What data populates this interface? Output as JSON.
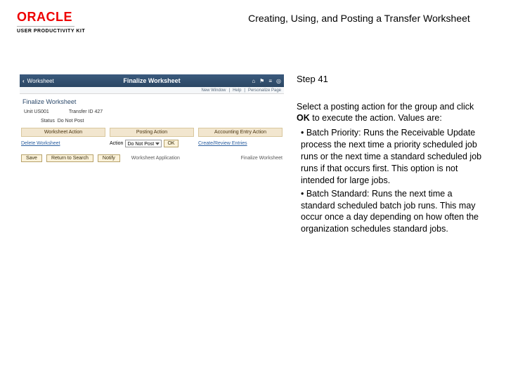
{
  "header": {
    "brand": "ORACLE",
    "subbrand": "USER PRODUCTIVITY KIT",
    "title": "Creating, Using, and Posting a Transfer Worksheet"
  },
  "app": {
    "back_glyph": "‹",
    "bar_small": "Worksheet",
    "bar_center": "Finalize Worksheet",
    "icons": {
      "home": "⌂",
      "flag": "⚑",
      "menu": "≡",
      "target": "◎"
    },
    "sublinks": [
      "New Window",
      "Help",
      "Personalize Page"
    ],
    "panel_title": "Finalize Worksheet",
    "info": {
      "unit_label": "Unit",
      "unit_value": "US001",
      "transfer_label": "Transfer ID",
      "transfer_value": "427",
      "status_label": "Status",
      "status_value": "Do Not Post"
    },
    "sections": {
      "ws": "Worksheet Action",
      "post": "Posting Action",
      "acct": "Accounting Entry Action"
    },
    "actions": {
      "delete_ws": "Delete Worksheet",
      "action_label": "Action",
      "action_value": "Do Not Post",
      "ok": "OK",
      "create_review": "Create/Review Entries"
    },
    "footer": {
      "save": "Save",
      "return": "Return to Search",
      "notify": "Notify",
      "mid": "Worksheet Application",
      "right": "Finalize Worksheet"
    }
  },
  "instruction": {
    "step": "Step 41",
    "intro_a": "Select a posting action for the group and click ",
    "intro_b": "OK",
    "intro_c": " to execute the action. Values are:",
    "b1": " • Batch Priority: Runs the Receivable Update process the next time a priority scheduled job runs or the next time a standard scheduled job runs if that occurs first. This option is not intended for large jobs.",
    "b2": " • Batch Standard: Runs the next time a standard scheduled batch job runs. This may occur once a day depending on how often the organization schedules standard jobs."
  }
}
